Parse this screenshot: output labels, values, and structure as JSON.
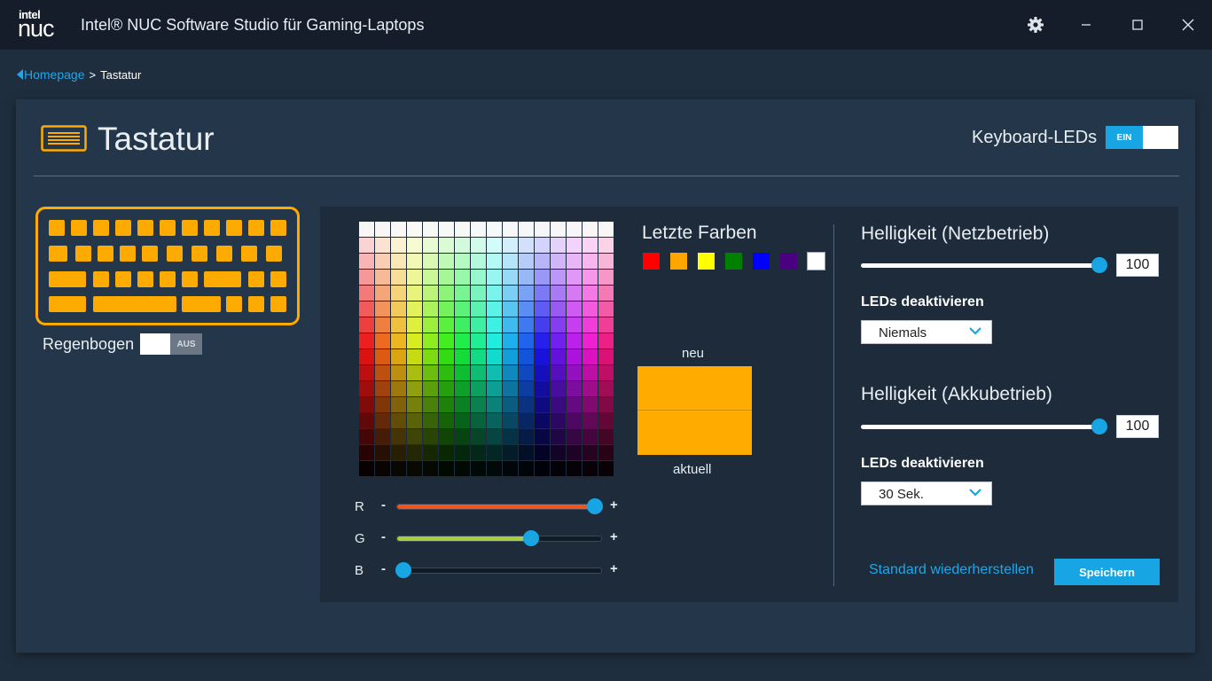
{
  "app": {
    "logo_top": "intel",
    "logo_bottom": "nuc",
    "title": "Intel® NUC Software Studio für Gaming-Laptops"
  },
  "breadcrumb": {
    "home": "Homepage",
    "separator": ">",
    "current": "Tastatur"
  },
  "header": {
    "title": "Tastatur",
    "led_label": "Keyboard-LEDs",
    "led_toggle": "EIN",
    "led_on": true
  },
  "rainbow": {
    "label": "Regenbogen",
    "toggle": "AUS",
    "on": false
  },
  "colors": {
    "accent": "#17a5e4",
    "keyboard": "#fdab00"
  },
  "rgb_sliders": [
    {
      "label": "R",
      "minus": "-",
      "plus": "+",
      "value": 255,
      "color": "#f0541f"
    },
    {
      "label": "G",
      "minus": "-",
      "plus": "+",
      "value": 170,
      "color": "#a6cf3d"
    },
    {
      "label": "B",
      "minus": "-",
      "plus": "+",
      "value": 0,
      "color": "#17a5e4"
    }
  ],
  "recent": {
    "title": "Letzte Farben",
    "swatches": [
      "#ff0000",
      "#ffa500",
      "#ffff00",
      "#008000",
      "#0000ff",
      "#4b0082",
      "#ffffff"
    ]
  },
  "preview": {
    "new_label": "neu",
    "current_label": "aktuell",
    "new_color": "#ffab00",
    "current_color": "#ffab00"
  },
  "mains": {
    "title": "Helligkeit (Netzbetrieb)",
    "value": "100",
    "disable_label": "LEDs deaktivieren",
    "disable_value": "Niemals"
  },
  "battery": {
    "title": "Helligkeit (Akkubetrieb)",
    "value": "100",
    "disable_label": "LEDs deaktivieren",
    "disable_value": "30 Sek."
  },
  "actions": {
    "reset": "Standard wiederherstellen",
    "save": "Speichern"
  }
}
